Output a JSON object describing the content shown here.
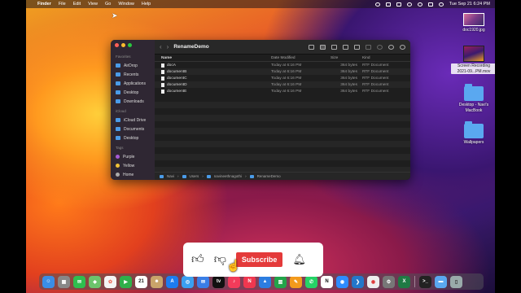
{
  "menubar": {
    "apple": "",
    "app": "Finder",
    "items": [
      "File",
      "Edit",
      "View",
      "Go",
      "Window",
      "Help"
    ],
    "clock": "Tue Sep 21  6:24 PM"
  },
  "finder": {
    "title": "RenameDemo",
    "sidebar": {
      "favorites_header": "Favorites",
      "favorites": [
        "AirDrop",
        "Recents",
        "Applications",
        "Desktop",
        "Downloads"
      ],
      "icloud_header": "iCloud",
      "icloud": [
        "iCloud Drive",
        "Documents",
        "Desktop"
      ],
      "tags_header": "Tags",
      "tags": [
        "Purple",
        "Yellow",
        "Home"
      ]
    },
    "columns": {
      "name": "Name",
      "date": "Date Modified",
      "size": "Size",
      "kind": "Kind"
    },
    "files": [
      {
        "name": "docA",
        "date": "Today at 6:16 PM",
        "size": "364 bytes",
        "kind": "RTF Document"
      },
      {
        "name": "documentB",
        "date": "Today at 6:16 PM",
        "size": "364 bytes",
        "kind": "RTF Document"
      },
      {
        "name": "documentC",
        "date": "Today at 6:16 PM",
        "size": "364 bytes",
        "kind": "RTF Document"
      },
      {
        "name": "documentD",
        "date": "Today at 6:16 PM",
        "size": "364 bytes",
        "kind": "RTF Document"
      },
      {
        "name": "documentE",
        "date": "Today at 6:16 PM",
        "size": "364 bytes",
        "kind": "RTF Document"
      }
    ],
    "path": [
      "Navi",
      "Users",
      "navineethnagothi",
      "RenameDemo"
    ]
  },
  "desktop": {
    "icons": [
      {
        "label": "doc1920.jpg"
      },
      {
        "label": "Screen Recording 2021-09...PM.mov"
      },
      {
        "label": "Desktop - Navi's MacBook"
      },
      {
        "label": "Wallpapers"
      }
    ]
  },
  "overlay": {
    "subscribe": "Subscribe"
  },
  "dock": {
    "icons": [
      "finder-icon",
      "launchpad-icon",
      "messages-icon",
      "maps-icon",
      "photos-icon",
      "facetime-icon",
      "calendar-icon",
      "contacts-icon",
      "appstore-icon",
      "safari-icon",
      "mail-icon",
      "appletv-icon",
      "music-icon",
      "news-icon",
      "keynote-icon",
      "numbers-icon",
      "pages-icon",
      "whatsapp-icon",
      "notion-icon",
      "zoom-icon",
      "vscode-icon",
      "chrome-icon",
      "settings-icon",
      "excel-icon",
      "terminal-icon",
      "folder-icon",
      "trash-icon"
    ],
    "calendar_day": "21"
  },
  "colors": {
    "accent": "#4a9be8",
    "subscribe": "#e43a3a"
  }
}
